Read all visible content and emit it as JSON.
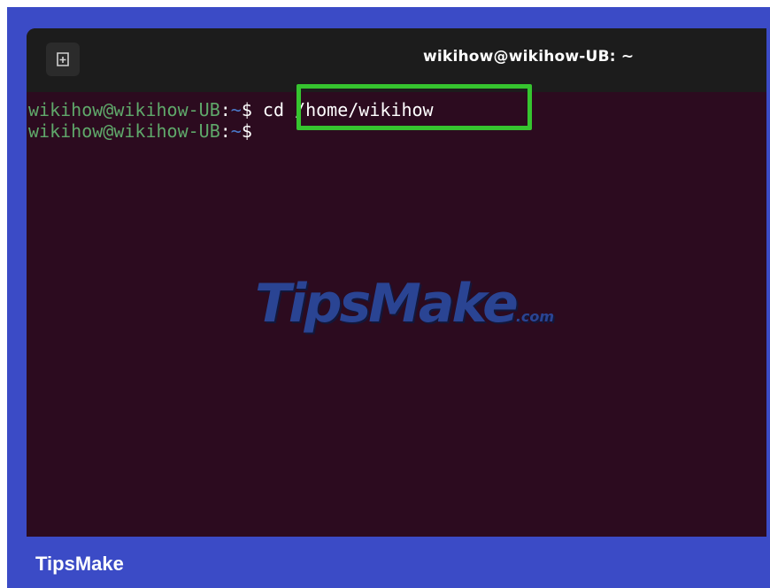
{
  "window": {
    "title": "wikihow@wikihow-UB: ~"
  },
  "terminal": {
    "lines": [
      {
        "user_host": "wikihow@wikihow-UB",
        "colon": ":",
        "path": "~",
        "prompt": "$",
        "command": " cd /home/wikihow"
      },
      {
        "user_host": "wikihow@wikihow-UB",
        "colon": ":",
        "path": "~",
        "prompt": "$",
        "command": ""
      }
    ]
  },
  "watermark": {
    "brand": "TipsMake",
    "suffix": ".com"
  },
  "footer": {
    "caption": "TipsMake"
  },
  "colors": {
    "frame": "#3b4bc6",
    "terminal_bg": "#2c0b1f",
    "titlebar_bg": "#1c1c1c",
    "highlight": "#36c42f",
    "prompt_user": "#5fa86a",
    "prompt_path": "#4a78c8"
  },
  "icons": {
    "new_tab": "new-tab-icon"
  }
}
